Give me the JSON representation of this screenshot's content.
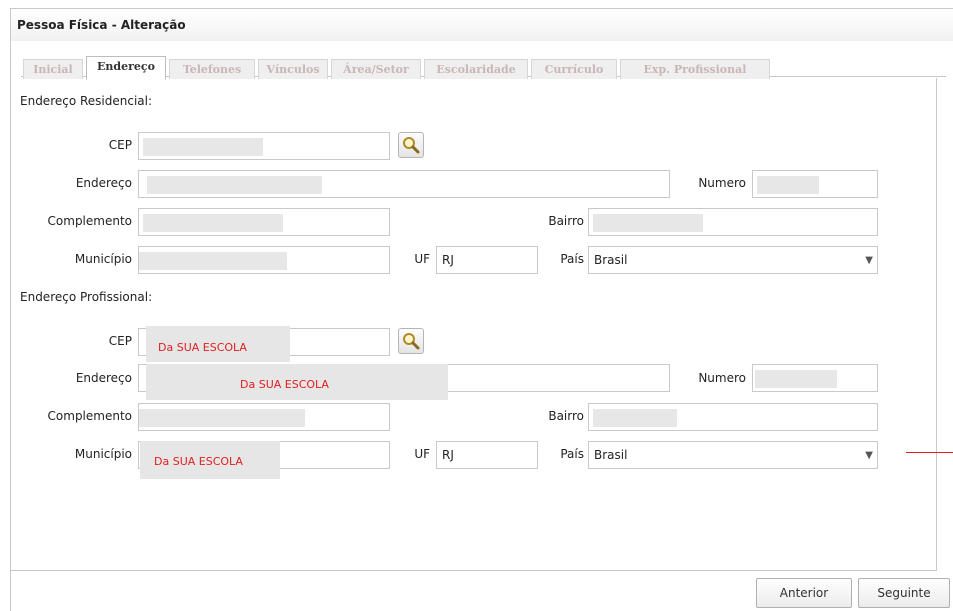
{
  "window": {
    "title": "Pessoa Física - Alteração"
  },
  "tabs": [
    {
      "label": "Inicial",
      "active": false
    },
    {
      "label": "Endereço",
      "active": true
    },
    {
      "label": "Telefones",
      "active": false
    },
    {
      "label": "Vínculos",
      "active": false
    },
    {
      "label": "Área/Setor",
      "active": false
    },
    {
      "label": "Escolaridade",
      "active": false
    },
    {
      "label": "Currículo",
      "active": false
    },
    {
      "label": "Exp. Profissional",
      "active": false
    }
  ],
  "residencial": {
    "heading": "Endereço Residencial:",
    "cep_label": "CEP",
    "endereco_label": "Endereço",
    "numero_label": "Numero",
    "complemento_label": "Complemento",
    "bairro_label": "Bairro",
    "municipio_label": "Município",
    "uf_label": "UF",
    "uf_value": "RJ",
    "pais_label": "País",
    "pais_value": "Brasil"
  },
  "profissional": {
    "heading": "Endereço Profissional:",
    "cep_label": "CEP",
    "cep_note": "Da SUA ESCOLA",
    "endereco_label": "Endereço",
    "endereco_note": "Da SUA ESCOLA",
    "numero_label": "Numero",
    "complemento_label": "Complemento",
    "bairro_label": "Bairro",
    "municipio_label": "Município",
    "municipio_note": "Da SUA ESCOLA",
    "uf_label": "UF",
    "uf_value": "RJ",
    "pais_label": "País",
    "pais_value": "Brasil"
  },
  "buttons": {
    "anterior": "Anterior",
    "seguinte": "Seguinte"
  },
  "icons": {
    "cep_search": "magnifier-icon",
    "select": "chevron-down-icon"
  }
}
